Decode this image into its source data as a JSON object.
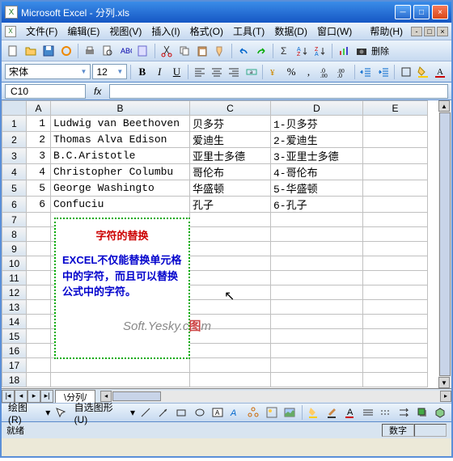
{
  "title": "Microsoft Excel - 分列.xls",
  "menus": {
    "file": "文件(F)",
    "edit": "编辑(E)",
    "view": "视图(V)",
    "insert": "插入(I)",
    "format": "格式(O)",
    "tools": "工具(T)",
    "data": "数据(D)",
    "window": "窗口(W)",
    "help": "帮助(H)"
  },
  "font": {
    "name": "宋体",
    "size": "12"
  },
  "namebox": "C10",
  "fx_label": "fx",
  "columns": [
    "A",
    "B",
    "C",
    "D",
    "E"
  ],
  "rows": [
    {
      "n": "1",
      "a": "1",
      "b": "Ludwig van Beethoven",
      "c": "贝多芬",
      "d": "1-贝多芬"
    },
    {
      "n": "2",
      "a": "2",
      "b": "Thomas Alva Edison",
      "c": "爱迪生",
      "d": "2-爱迪生"
    },
    {
      "n": "3",
      "a": "3",
      "b": "B.C.Aristotle",
      "c": "亚里士多德",
      "d": "3-亚里士多德"
    },
    {
      "n": "4",
      "a": "4",
      "b": "Christopher Columbu",
      "c": "哥伦布",
      "d": "4-哥伦布"
    },
    {
      "n": "5",
      "a": "5",
      "b": "George Washingto",
      "c": "华盛顿",
      "d": "5-华盛顿"
    },
    {
      "n": "6",
      "a": "6",
      "b": "Confuciu",
      "c": "孔子",
      "d": "6-孔子"
    }
  ],
  "blank_rows": [
    "7",
    "8",
    "9",
    "10",
    "11",
    "12",
    "13",
    "14",
    "15",
    "16",
    "17",
    "18"
  ],
  "textbox": {
    "title": "字符的替换",
    "body": "EXCEL不仅能替换单元格中的字符，而且可以替换公式中的字符。"
  },
  "watermark": {
    "text": "Soft.Yesky.c",
    "suffix": "图",
    "suffix2": "m"
  },
  "tab": "分列",
  "draw": {
    "label": "绘图(R)",
    "shapes": "自选图形(U)"
  },
  "status": {
    "ready": "就绪",
    "num": "数字"
  },
  "chart_data": null
}
